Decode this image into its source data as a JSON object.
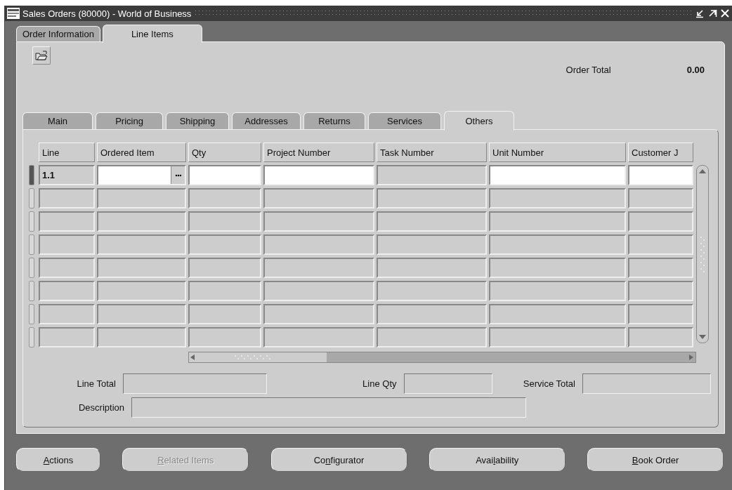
{
  "window": {
    "title": "Sales Orders (80000) - World of Business"
  },
  "tabs": [
    {
      "label": "Order Information",
      "selected": false
    },
    {
      "label": "Line Items",
      "selected": true
    }
  ],
  "order_total": {
    "label": "Order Total",
    "value": "0.00"
  },
  "sub_tabs": [
    {
      "label": "Main",
      "selected": false
    },
    {
      "label": "Pricing",
      "selected": false
    },
    {
      "label": "Shipping",
      "selected": false
    },
    {
      "label": "Addresses",
      "selected": false
    },
    {
      "label": "Returns",
      "selected": false
    },
    {
      "label": "Services",
      "selected": false
    },
    {
      "label": "Others",
      "selected": true
    }
  ],
  "table": {
    "columns": [
      {
        "label": "Line",
        "editable": false
      },
      {
        "label": "Ordered Item",
        "editable": true,
        "lov": true
      },
      {
        "label": "Qty",
        "editable": true
      },
      {
        "label": "Project Number",
        "editable": true
      },
      {
        "label": "Task Number",
        "editable": false
      },
      {
        "label": "Unit Number",
        "editable": true
      },
      {
        "label": "Customer J",
        "editable": true
      }
    ],
    "rows": [
      {
        "line": "1.1",
        "current": true
      },
      {
        "current": false
      },
      {
        "current": false
      },
      {
        "current": false
      },
      {
        "current": false
      },
      {
        "current": false
      },
      {
        "current": false
      },
      {
        "current": false
      }
    ]
  },
  "totals": [
    {
      "label": "Line Total"
    },
    {
      "label": "Line Qty"
    },
    {
      "label": "Service Total"
    }
  ],
  "description": {
    "label": "Description"
  },
  "buttons": [
    {
      "mnemonic": "A",
      "after": "ctions",
      "disabled": false
    },
    {
      "mnemonic": "R",
      "after": "elated Items",
      "disabled": true
    },
    {
      "before": "Co",
      "mnemonic": "n",
      "after": "figurator",
      "disabled": false
    },
    {
      "before": "Avai",
      "mnemonic": "l",
      "after": "ability",
      "disabled": false
    },
    {
      "mnemonic": "B",
      "after": "ook Order",
      "disabled": false
    }
  ]
}
